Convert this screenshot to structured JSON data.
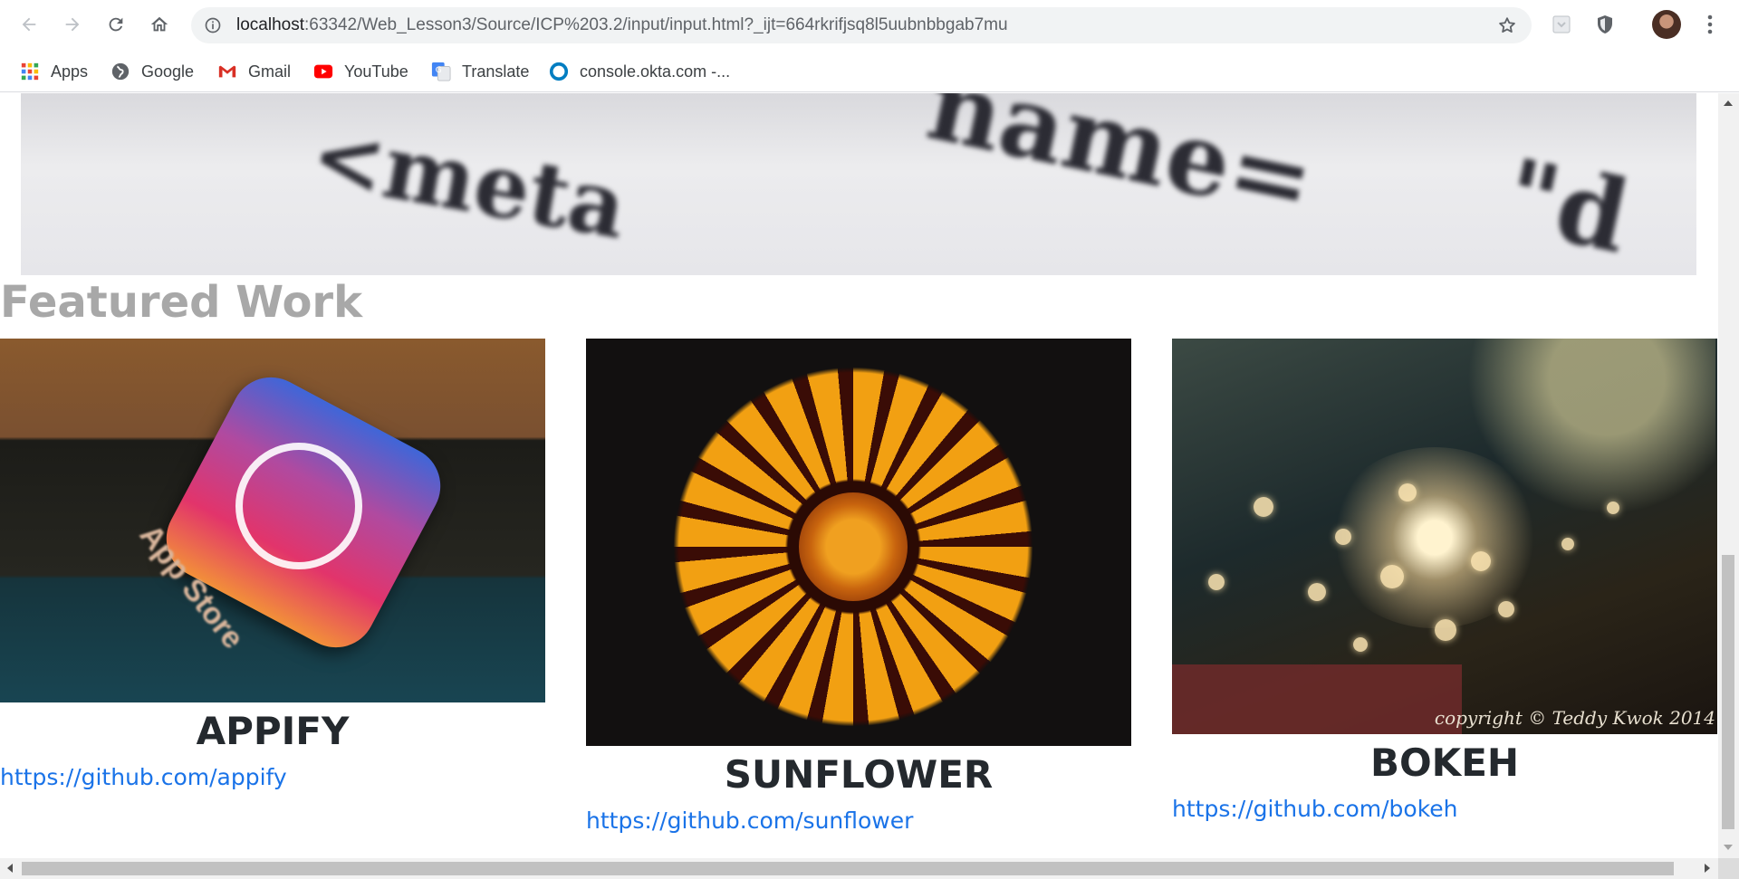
{
  "browser": {
    "url_host": "localhost",
    "url_rest": ":63342/Web_Lesson3/Source/ICP%203.2/input/input.html?_ijt=664rkrifjsq8l5uubnbbgab7mu"
  },
  "bookmarks": [
    {
      "label": "Apps",
      "icon": "apps-grid-icon"
    },
    {
      "label": "Google",
      "icon": "google-icon"
    },
    {
      "label": "Gmail",
      "icon": "gmail-icon"
    },
    {
      "label": "YouTube",
      "icon": "youtube-icon"
    },
    {
      "label": "Translate",
      "icon": "translate-icon"
    },
    {
      "label": "console.okta.com -...",
      "icon": "okta-icon"
    }
  ],
  "page": {
    "hero_words": [
      "<meta",
      "name=",
      "\"d"
    ],
    "section_title": "Featured Work",
    "projects": [
      {
        "name": "APPIFY",
        "link": "https://github.com/appify",
        "photo_caption": "App Store"
      },
      {
        "name": "SUNFLOWER",
        "link": "https://github.com/sunflower"
      },
      {
        "name": "BOKEH",
        "link": "https://github.com/bokeh",
        "photo_caption": "copyright © Teddy Kwok 2014"
      }
    ]
  },
  "colors": {
    "link": "#1a73e8",
    "heading_muted": "#a8a8a8",
    "project_title": "#24292e"
  }
}
